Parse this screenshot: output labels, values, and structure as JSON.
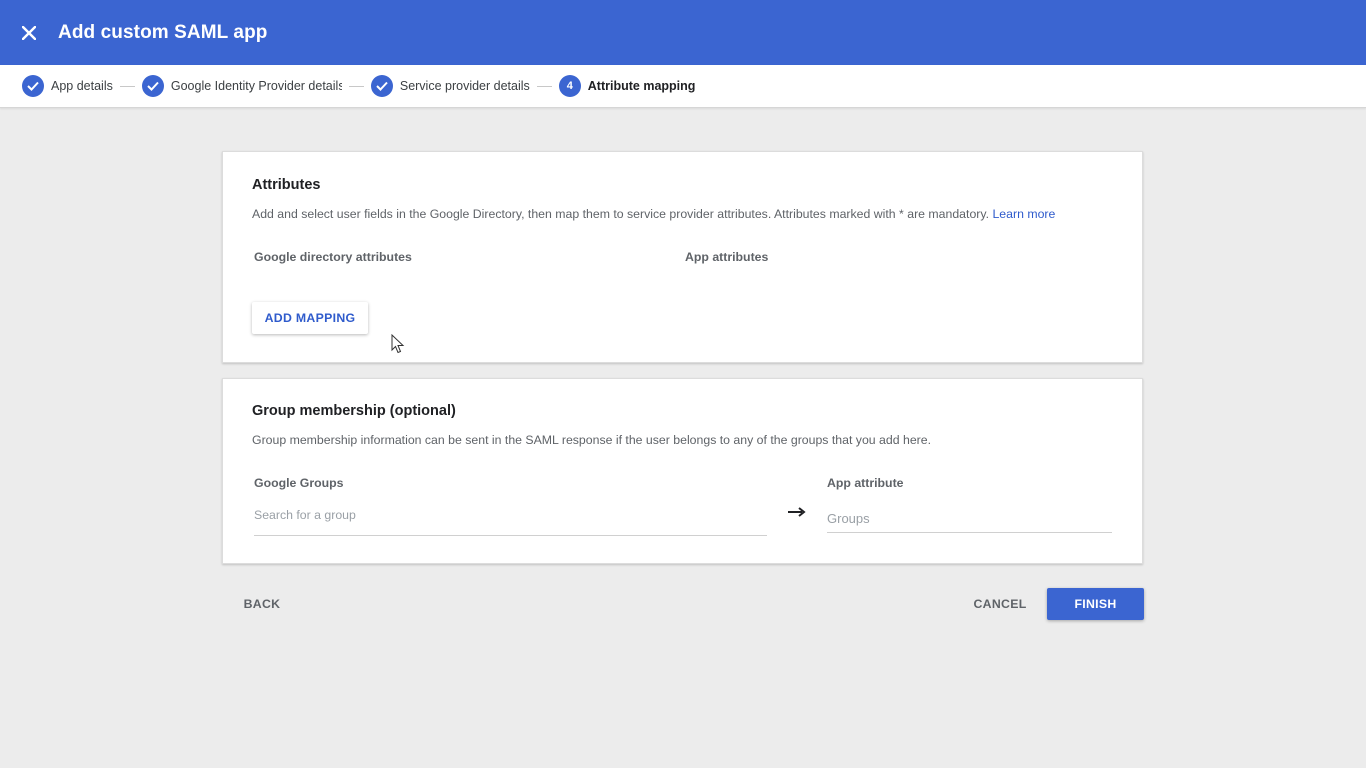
{
  "header": {
    "title": "Add custom SAML app",
    "close_icon": "close-icon",
    "background": "#3b65d1"
  },
  "stepper": {
    "steps": [
      {
        "label": "App details",
        "status": "complete",
        "icon": "check-icon"
      },
      {
        "label": "Google Identity Provider details",
        "status": "complete",
        "icon": "check-icon"
      },
      {
        "label": "Service provider details",
        "status": "complete",
        "icon": "check-icon"
      },
      {
        "label": "Attribute mapping",
        "status": "active",
        "number": "4"
      }
    ]
  },
  "attributes_card": {
    "title": "Attributes",
    "description": "Add and select user fields in the Google Directory, then map them to service provider attributes. Attributes marked with * are mandatory.",
    "learn_more": "Learn more",
    "col_google": "Google directory attributes",
    "col_app": "App attributes",
    "add_mapping": "ADD MAPPING"
  },
  "groups_card": {
    "title": "Group membership (optional)",
    "description": "Group membership information can be sent in the SAML response if the user belongs to any of the groups that you add here.",
    "col_google": "Google Groups",
    "col_app": "App attribute",
    "search_placeholder": "Search for a group",
    "app_attribute_placeholder": "Groups",
    "arrow_icon": "arrow-right-icon"
  },
  "footer": {
    "back": "BACK",
    "cancel": "CANCEL",
    "finish": "FINISH"
  },
  "colors": {
    "accent": "#3b65d1",
    "link": "#2f5bcc",
    "page_background": "#ececec"
  }
}
